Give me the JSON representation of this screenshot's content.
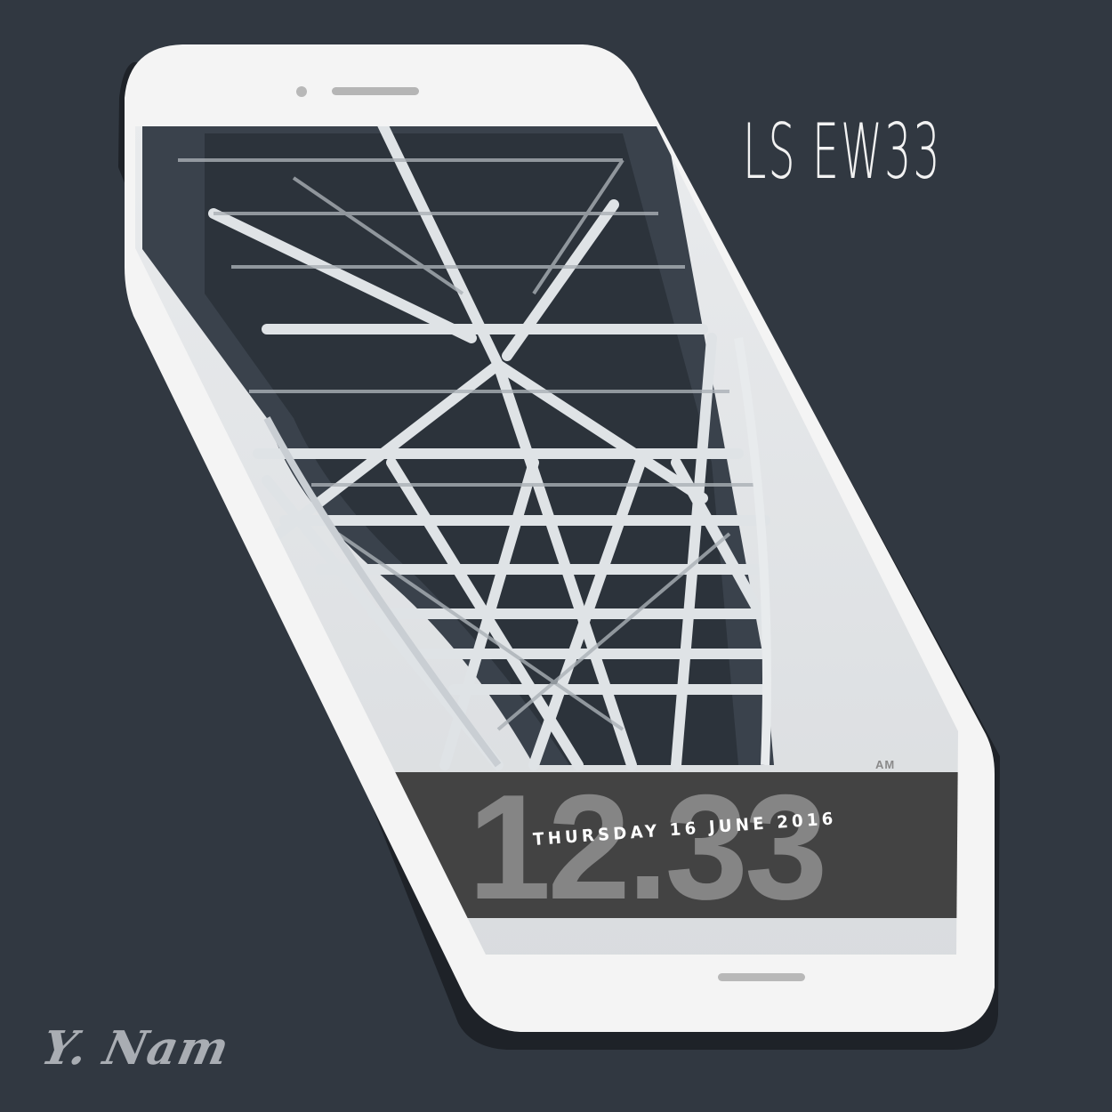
{
  "title": "LS EW33",
  "signature": "Y. Nam",
  "lockscreen": {
    "time": "12.33",
    "ampm": "AM",
    "date": "THURSDAY 16 JUNE 2016"
  },
  "colors": {
    "background": "#313841",
    "phone_body": "#f4f4f4",
    "clock_band": "#3c3c3c",
    "title_text": "#f2f2f2",
    "signature_text": "#a9adb3"
  },
  "icons": {
    "earpiece": "speaker-grille-icon",
    "camera": "front-camera-icon",
    "home": "home-bar-icon"
  }
}
